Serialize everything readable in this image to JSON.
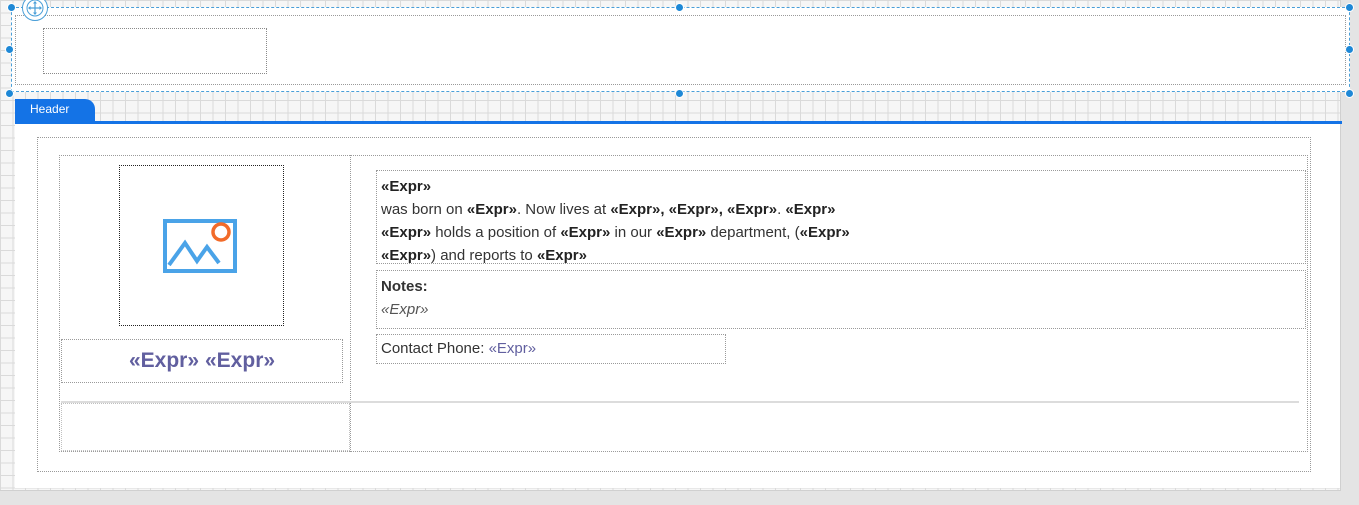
{
  "band": {
    "tab_label": "Header"
  },
  "card": {
    "name": {
      "first": "«Expr»",
      "last": "«Expr»"
    },
    "bio": {
      "e1": "«Expr»",
      "t1": " was born on ",
      "e2": "«Expr»",
      "t2": ". Now lives at ",
      "e3": "«Expr», «Expr», «Expr»",
      "t3": ". ",
      "e4": "«Expr»",
      "e5": "«Expr»",
      "t4": " holds a position of ",
      "e6": "«Expr»",
      "t5": " in our ",
      "e7": "«Expr»",
      "t6": " department, (",
      "e8": "«Expr»",
      "e9": "«Expr»",
      "t7": ") and reports to ",
      "e10": "«Expr»"
    },
    "notes": {
      "label": "Notes:",
      "value": "«Expr»"
    },
    "phone": {
      "label": "Contact Phone: ",
      "value": "«Expr»"
    }
  },
  "colors": {
    "accent": "#1473e6",
    "expression": "#615f9f",
    "selection": "#4a9fd8"
  },
  "icons": {
    "photo": "image-placeholder-icon",
    "move": "move-arrows-icon"
  }
}
